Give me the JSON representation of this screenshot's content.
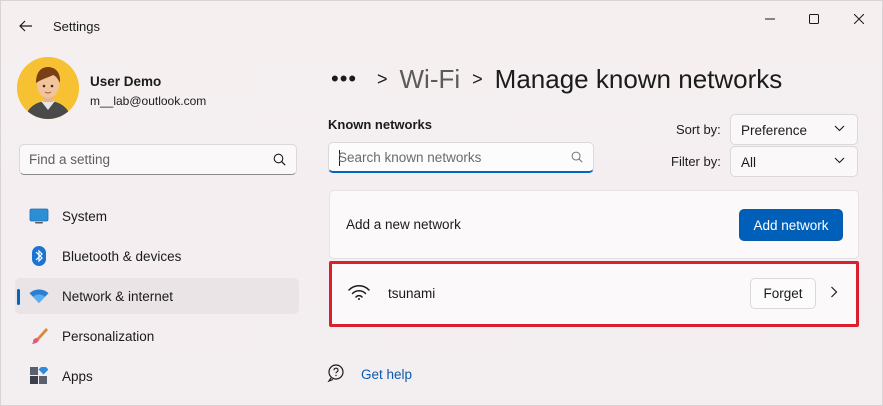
{
  "window": {
    "app_title": "Settings"
  },
  "user": {
    "name": "User Demo",
    "email": "m__lab@outlook.com"
  },
  "sidebar": {
    "search_placeholder": "Find a setting",
    "items": [
      {
        "label": "System",
        "icon": "monitor-icon"
      },
      {
        "label": "Bluetooth & devices",
        "icon": "bluetooth-icon"
      },
      {
        "label": "Network & internet",
        "icon": "wifi-icon",
        "active": true
      },
      {
        "label": "Personalization",
        "icon": "brush-icon"
      },
      {
        "label": "Apps",
        "icon": "apps-icon"
      }
    ]
  },
  "breadcrumb": {
    "more": "•••",
    "sep": ">",
    "parent": "Wi-Fi",
    "current": "Manage known networks"
  },
  "known_networks": {
    "label": "Known networks",
    "search_placeholder": "Search known networks",
    "sort_label": "Sort by:",
    "sort_value": "Preference",
    "filter_label": "Filter by:",
    "filter_value": "All"
  },
  "add_network": {
    "label": "Add a new network",
    "button": "Add network"
  },
  "networks": [
    {
      "name": "tsunami",
      "forget_label": "Forget"
    }
  ],
  "help": {
    "label": "Get help"
  },
  "colors": {
    "accent": "#005fb8",
    "highlight_border": "#d9202c"
  }
}
